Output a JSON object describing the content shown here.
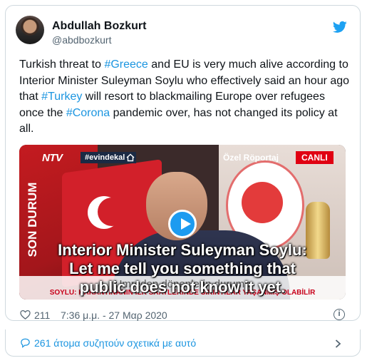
{
  "author": {
    "name": "Abdullah Bozkurt",
    "handle": "@abdbozkurt"
  },
  "tweet": {
    "p1": "Turkish threat to ",
    "tag1": "#Greece",
    "p2": " and EU is very much alive according to Interior Minister Suleyman Soylu who effectively said an hour ago that ",
    "tag2": "#Turkey",
    "p3": " will resort to blackmailing Europe over refugees once the ",
    "tag3": "#Corona",
    "p4": " pandemic over, has not changed its policy at all."
  },
  "media": {
    "channel": "NTV",
    "hashtag": "#evindekal",
    "ozel": "Özel Röportaj",
    "canli": "CANLI",
    "son_durum": "SON DURUM",
    "caption_line1": "Interior Minister Suleyman Soylu:",
    "caption_line2": "Let me tell you something that",
    "caption_line3": "public does not know it yet.",
    "ticker_top": "Umreden dönenlerin durumu",
    "ticker": "SOYLU: KARANTİNANIN İLK SAATLERİNDE SIKINTILAR YAŞANMIŞ OLABİLİR"
  },
  "footer": {
    "likes": "211",
    "time": "7:36 μ.μ. - 27 Μαρ 2020",
    "discuss": "261 άτομα συζητούν σχετικά με αυτό"
  },
  "colors": {
    "link": "#1b95e0",
    "text": "#0f1419",
    "muted": "#536471",
    "accent_red": "#e00012"
  }
}
